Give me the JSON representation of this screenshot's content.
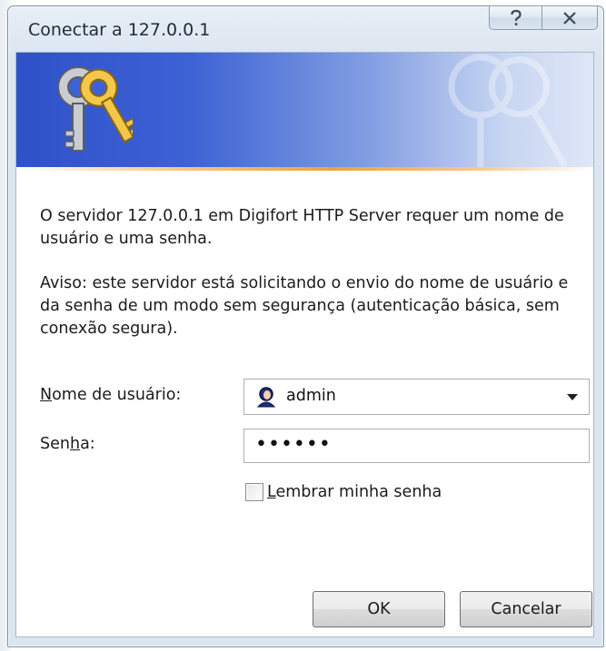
{
  "window": {
    "title": "Conectar a 127.0.0.1",
    "help_icon": "question-mark-icon",
    "close_icon": "close-x-icon"
  },
  "banner": {
    "icon": "keys-icon",
    "colors": {
      "banner_left": "#2f51c9",
      "banner_right": "#dfe7f7",
      "accent_line": "#f0a040"
    }
  },
  "messages": {
    "server_message": "O servidor 127.0.0.1 em Digifort HTTP Server requer um nome de usuário e uma senha.",
    "warning_message": "Aviso: este servidor está solicitando o envio do nome de usuário e da senha de um modo sem segurança (autenticação básica, sem conexão segura)."
  },
  "form": {
    "username_label": "Nome de usuário:",
    "username_label_access_key": "N",
    "username_value": "admin",
    "username_icon": "user-icon",
    "password_label": "Senha:",
    "password_label_access_key": "h",
    "password_value": "••••••",
    "remember_label": "Lembrar minha senha",
    "remember_checked": false
  },
  "buttons": {
    "ok_label": "OK",
    "cancel_label": "Cancelar"
  }
}
